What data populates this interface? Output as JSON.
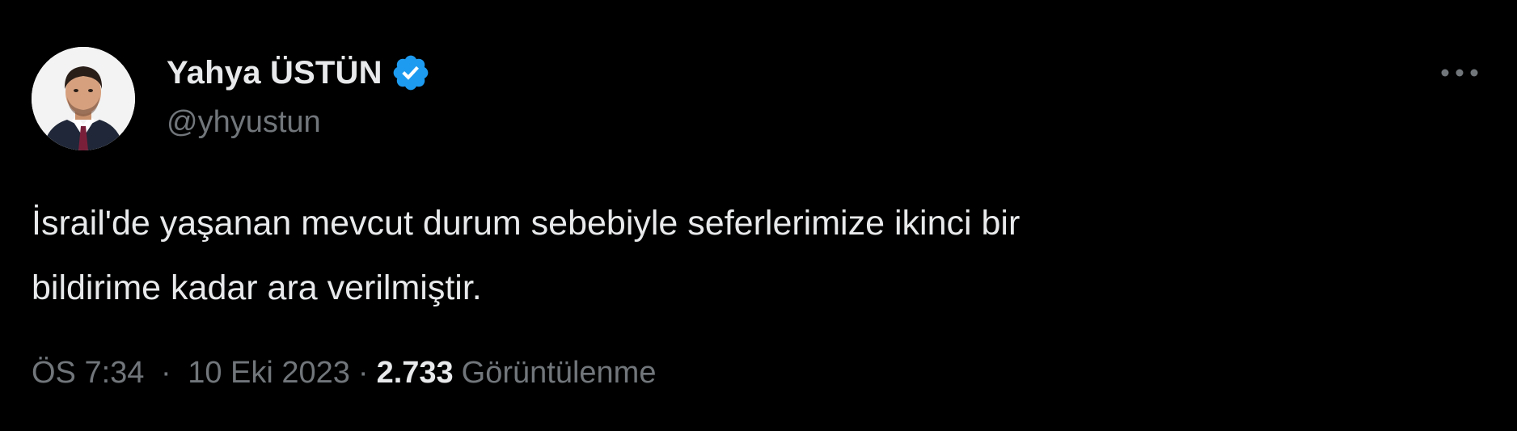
{
  "author": {
    "display_name": "Yahya ÜSTÜN",
    "handle": "@yhyustun",
    "verified": true,
    "verified_color": "#1d9bf0"
  },
  "tweet": {
    "text_lines": [
      "İsrail'de yaşanan mevcut durum sebebiyle seferlerimize ikinci bir",
      "bildirime kadar ara verilmiştir."
    ]
  },
  "meta": {
    "time": "ÖS 7:34",
    "separator": "·",
    "date": "10 Eki 2023",
    "views_count": "2.733",
    "views_label": "Görüntülenme"
  },
  "icons": {
    "more": "more-horizontal-icon",
    "verified": "verified-badge-icon"
  },
  "colors": {
    "background": "#000000",
    "primary_text": "#e7e9ea",
    "secondary_text": "#71767b"
  }
}
